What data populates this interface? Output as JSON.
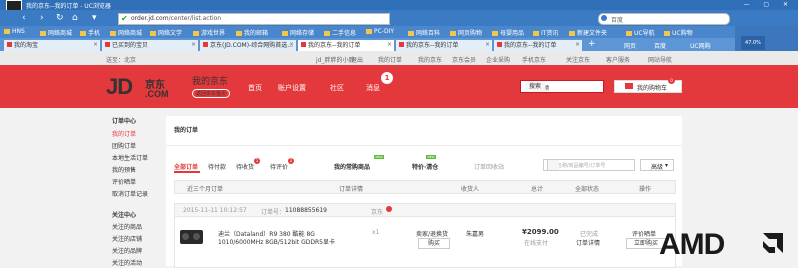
{
  "browser": {
    "title": "我的京东--我的订单 - UC浏览器",
    "address_host": "order.jd.com",
    "address_path": "/center/list.action",
    "search_placeholder": "百度",
    "nav": {
      "back": "‹",
      "forward": "›",
      "refresh": "↻",
      "home": "⌂",
      "menu": "▾"
    },
    "bookmarks": [
      "HNS",
      "网络商城",
      "手机",
      "网络商城",
      "网络文学",
      "游戏世界",
      "我的邮箱",
      "网络存储",
      "二手信息",
      "PC-DIY",
      "网络百科",
      "网页购物",
      "母婴用品",
      "IT资讯",
      "新建文件夹",
      "UC导航",
      "UC购物"
    ],
    "tabs": [
      {
        "label": "我的淘宝",
        "active": false
      },
      {
        "label": "已买到的宝贝",
        "active": false
      },
      {
        "label": "京东(JD.COM)-综合网购首选...",
        "active": false
      },
      {
        "label": "我的京东--我的订单",
        "active": true
      },
      {
        "label": "我的京东--我的订单",
        "active": false
      },
      {
        "label": "我的京东--我的订单",
        "active": false
      }
    ],
    "tab_close": "×",
    "tab_add": "+",
    "side_buttons": [
      "网页",
      "百度",
      "UC网购"
    ],
    "cpu_percent": "47.0%"
  },
  "jd_topbar": {
    "location": "送至：北京",
    "items": [
      "jd_胖胖的小胖",
      "退出",
      "我的订单",
      "我的京东",
      "京东会员",
      "企业采购",
      "手机京东",
      "关注京东",
      "客户服务",
      "网站导航"
    ]
  },
  "jd_header": {
    "logo": "JD",
    "logo_dotcom": ".COM",
    "logo_cn": "京东",
    "home_title": "我的京东",
    "back_link": "返回京东首页",
    "nav": [
      "首页",
      "账户设置",
      "社区",
      "消息"
    ],
    "message_count": "1",
    "search_value": "儿童车领",
    "search_button": "搜索",
    "cart_label": "我的购物车",
    "cart_count": "0"
  },
  "sidebar": {
    "sections": [
      {
        "title": "订单中心",
        "items": [
          "我的订单",
          "团购订单",
          "本地生活订单",
          "我的预售",
          "评价晒单",
          "取消订单记录"
        ]
      },
      {
        "title": "关注中心",
        "items": [
          "关注的商品",
          "关注的店铺",
          "关注的品牌",
          "关注的活动"
        ]
      }
    ]
  },
  "orders": {
    "breadcrumb": "我的订单",
    "tabs": [
      {
        "label": "全部订单",
        "badge": "",
        "active": true
      },
      {
        "label": "待付款",
        "badge": "",
        "active": false
      },
      {
        "label": "待收货",
        "badge": "1",
        "active": false
      },
      {
        "label": "待评价",
        "badge": "2",
        "active": false
      }
    ],
    "extra_tabs": [
      {
        "label": "我的常购商品",
        "tag": "NEW"
      },
      {
        "label": "特价·清仓",
        "tag": "NEW"
      }
    ],
    "recycle": "订单回收站",
    "search_placeholder": "商品名称/商品编号/订单号",
    "more_label": "高级",
    "headers": {
      "time_filter": "近三个月订单",
      "detail": "订单详情",
      "receiver": "收货人",
      "amount": "总计",
      "status": "全部状态",
      "action": "操作"
    },
    "order": {
      "date": "2015-11-11 10:12:57",
      "order_no_label": "订单号：",
      "order_no": "11088855619",
      "shop": "京东",
      "product_name_1": "迪兰（Dataland）R9 380 酷能 8G",
      "product_name_2": "1010/6000MHz 8GB/512bit GDDR5显卡",
      "qty": "x1",
      "service_link": "卖家/退换货",
      "repurchase_btn": "购买",
      "receiver": "朱嘉男",
      "price": "¥2099.00",
      "payment": "在线支付",
      "status": "已完成",
      "detail_link": "订单详情",
      "review_link": "评价晒单",
      "buy_again": "立即购买"
    }
  },
  "overlay": {
    "brand": "AMD"
  },
  "colors": {
    "jd_red": "#e4393c",
    "browser_blue": "#3b7bc4",
    "new_tag": "#5fbe3b"
  }
}
